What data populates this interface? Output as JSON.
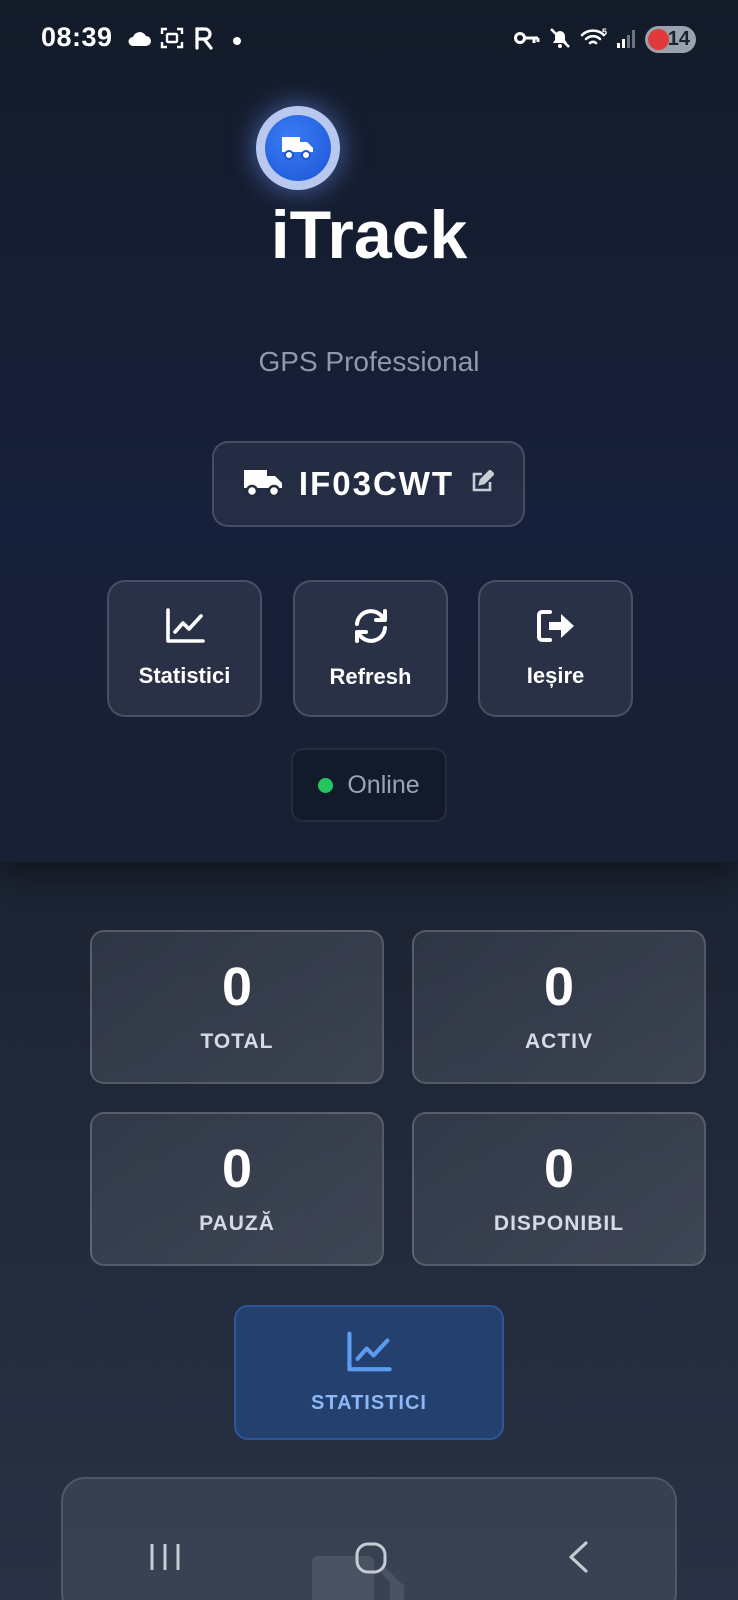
{
  "status_bar": {
    "time": "08:39",
    "battery": "14"
  },
  "header": {
    "title": "iTrack",
    "subtitle": "GPS Professional",
    "plate": "IF03CWT"
  },
  "actions": [
    {
      "label": "Statistici",
      "icon": "chart-line-icon"
    },
    {
      "label": "Refresh",
      "icon": "refresh-icon"
    },
    {
      "label": "Ieșire",
      "icon": "sign-out-icon"
    }
  ],
  "connection": {
    "status": "Online",
    "color": "#22c55e"
  },
  "stats": [
    {
      "value": "0",
      "label": "TOTAL"
    },
    {
      "value": "0",
      "label": "ACTIV"
    },
    {
      "value": "0",
      "label": "PAUZĂ"
    },
    {
      "value": "0",
      "label": "DISPONIBIL"
    }
  ],
  "stats_button": {
    "label": "STATISTICI",
    "icon": "chart-line-icon"
  },
  "colors": {
    "accent": "#2f6fe8",
    "online": "#22c55e",
    "background": "#1a2234"
  }
}
